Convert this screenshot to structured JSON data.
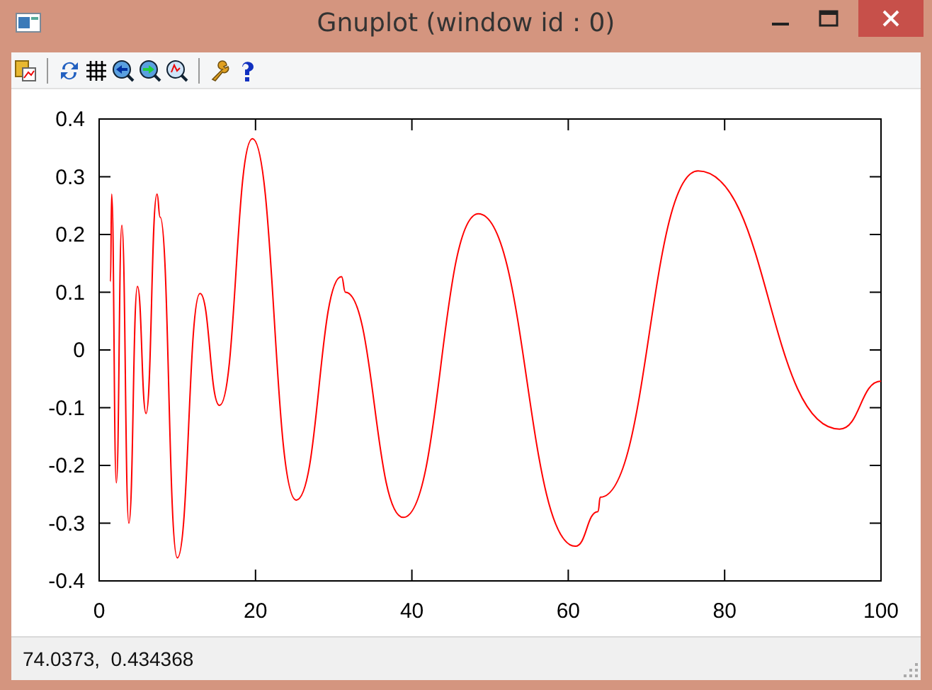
{
  "window": {
    "title": "Gnuplot (window id : 0)"
  },
  "plot": {
    "chart_data": {
      "type": "line",
      "x": [
        1.45,
        1.6,
        2.2,
        2.9,
        3.8,
        4.9,
        6,
        7.4,
        7.8,
        10,
        12.9,
        15.4,
        19.6,
        25.2,
        31,
        31.5,
        38.9,
        48.5,
        60.9,
        63.8,
        64.1,
        76.6,
        94.7,
        100
      ],
      "series": [
        {
          "color": "#ff0000",
          "values": [
            0.118,
            0.27,
            -0.23,
            0.216,
            -0.3,
            0.11,
            -0.11,
            0.27,
            0.23,
            -0.36,
            0.098,
            -0.096,
            0.366,
            -0.26,
            0.127,
            0.1,
            -0.29,
            0.236,
            -0.34,
            -0.28,
            -0.255,
            0.31,
            -0.137,
            -0.054
          ]
        }
      ],
      "xlim": [
        0,
        100
      ],
      "ylim": [
        -0.4,
        0.4
      ],
      "xticks": [
        0,
        20,
        40,
        60,
        80,
        100
      ],
      "yticks": [
        -0.4,
        -0.3,
        -0.2,
        -0.1,
        0,
        0.1,
        0.2,
        0.3,
        0.4
      ]
    }
  },
  "status_bar": {
    "coordinates": "74.0373,  0.434368"
  }
}
